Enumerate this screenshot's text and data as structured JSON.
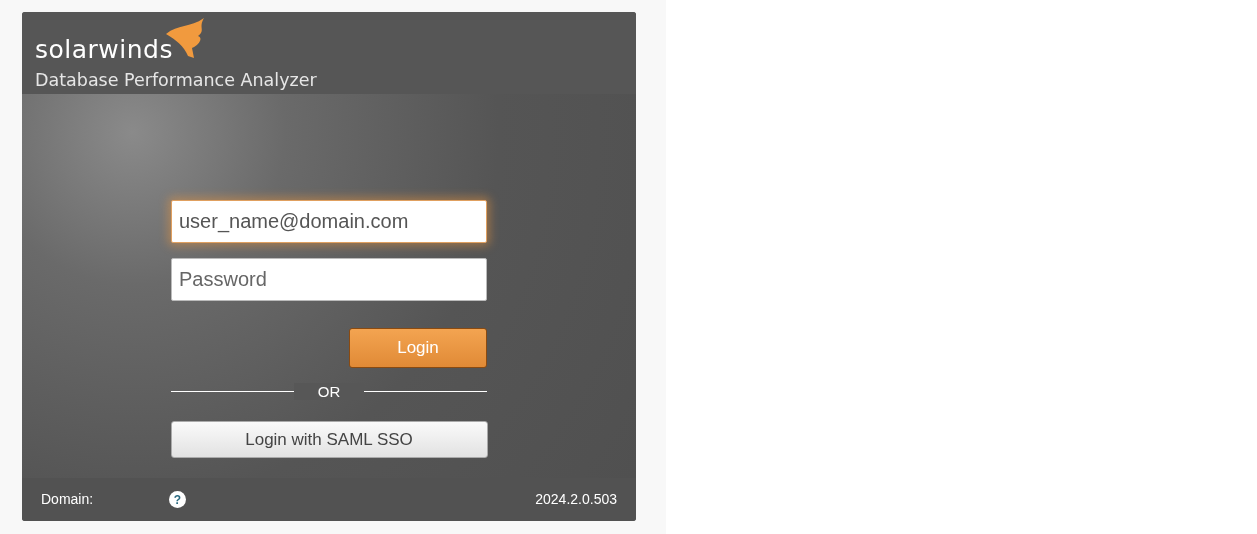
{
  "header": {
    "brand": "solarwinds",
    "product": "Database Performance Analyzer"
  },
  "form": {
    "username": {
      "value": "user_name@domain.com",
      "focused": true
    },
    "password": {
      "placeholder": "Password",
      "focused": false
    },
    "login_button": "Login",
    "separator": "OR",
    "sso_button": "Login with SAML SSO"
  },
  "footer": {
    "domain_label": "Domain:",
    "help_icon": "?",
    "version": "2024.2.0.503"
  }
}
